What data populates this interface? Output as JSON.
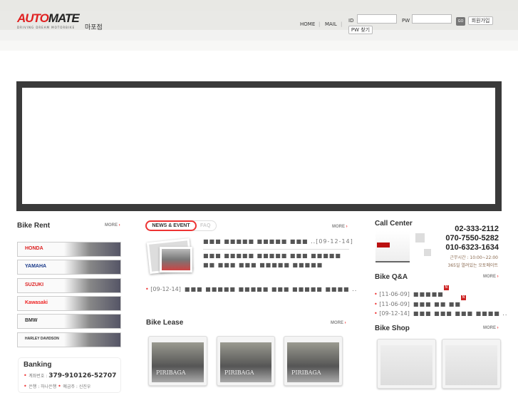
{
  "header": {
    "logo": "AUTOMATE",
    "logo_tagline": "DRIVING DREAM MOTORBIKE",
    "branch": "마포점",
    "nav": [
      "HOME",
      "MAIL"
    ],
    "id_label": "ID",
    "pw_label": "PW",
    "go": "GO",
    "signup": "회원가입",
    "find_pw": "PW 찾기"
  },
  "bike_rent": {
    "title": "Bike Rent",
    "more": "MORE",
    "brands": [
      "HONDA",
      "YAMAHA",
      "SUZUKI",
      "Kawasaki",
      "BMW",
      "HARLEY DAVIDSON"
    ]
  },
  "banking": {
    "title": "Banking",
    "account_label": "계좌번호 :",
    "account": "379-910126-52707",
    "bank": "은행 : 하나은행",
    "holder": "예금주 : 신진우"
  },
  "news": {
    "tabs": [
      "NEWS & EVENT",
      "FAQ"
    ],
    "more": "MORE",
    "featured_title": "■■■ ■■■■■ ■■■■■ ■■■ ..",
    "featured_date": "[09-12-14]",
    "featured_body": "■■■ ■■■■■ ■■■■■ ■■■ ■■■■■ ■■ ■■■ ■■■ ■■■■■ ■■■■■",
    "items": [
      {
        "date": "[09-12-14]",
        "title": "■■■ ■■■■■ ■■■■■ ■■■ ■■■■■ ■■■■ .."
      }
    ]
  },
  "bike_lease": {
    "title": "Bike Lease",
    "more": "MORE",
    "thumbs": [
      "PIRIBAGA",
      "PIRIBAGA",
      "PIRIBAGA"
    ]
  },
  "call_center": {
    "title": "Call Center",
    "phones": [
      "02-333-2112",
      "070-7550-5282",
      "010-6323-1634"
    ],
    "hours": "근무시간 : 10:00~22:00",
    "slogan": "365일 열려있는 오토메이트"
  },
  "qna": {
    "title": "Bike Q&A",
    "more": "MORE",
    "items": [
      {
        "date": "[11-06-09]",
        "title": "■■■■■",
        "new": "N"
      },
      {
        "date": "[11-06-09]",
        "title": "■■■ ■■ ■■",
        "new": "N"
      },
      {
        "date": "[09-12-14]",
        "title": "■■■ ■■■ ■■■ ■■■■ .."
      }
    ]
  },
  "shop": {
    "title": "Bike Shop",
    "more": "MORE"
  }
}
